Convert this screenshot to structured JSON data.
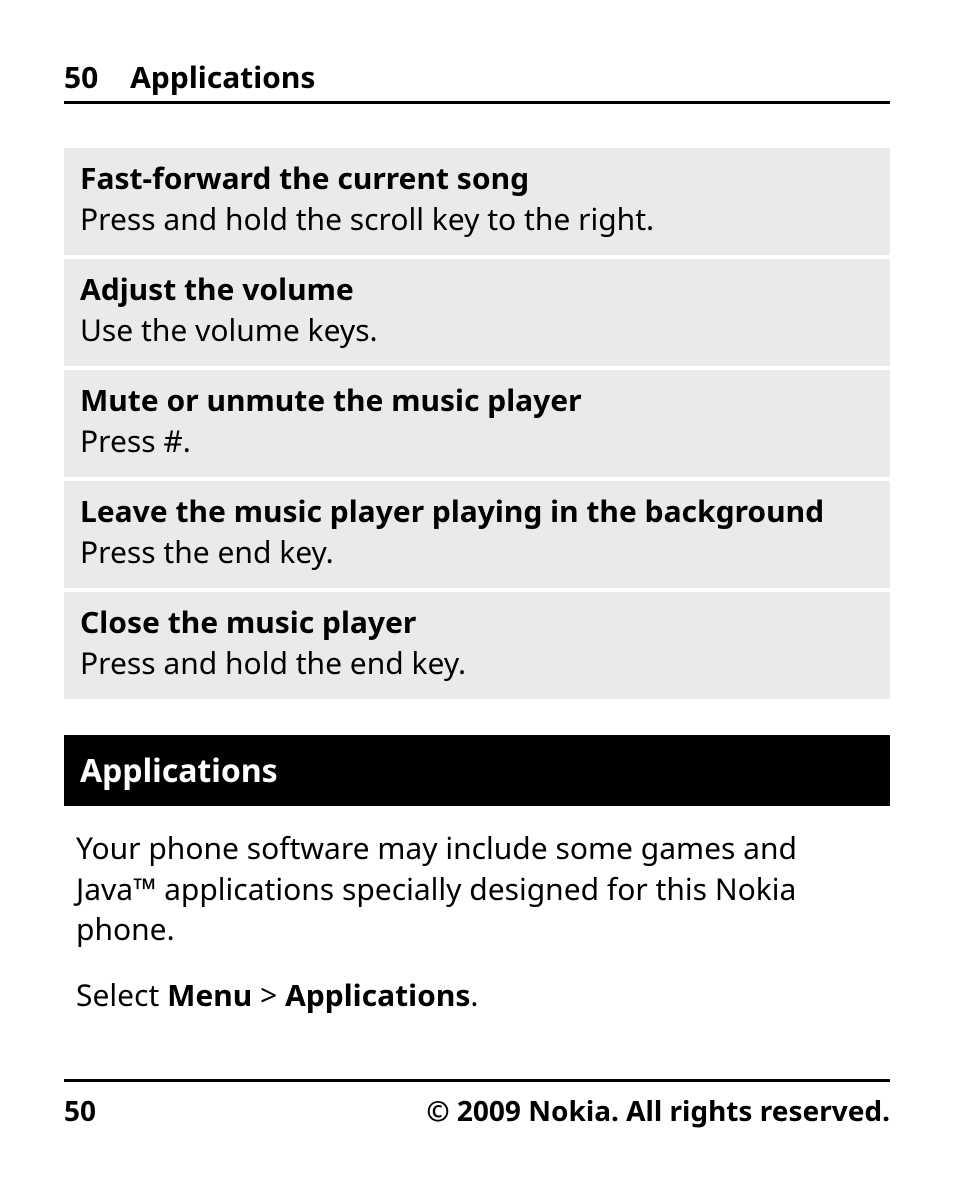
{
  "header": {
    "page_num": "50",
    "title": "Applications"
  },
  "instructions": [
    {
      "title": "Fast-forward the current song",
      "body": "Press and hold the scroll key to the right."
    },
    {
      "title": "Adjust the volume",
      "body": "Use the volume keys."
    },
    {
      "title": "Mute or unmute the music player",
      "body": "Press #."
    },
    {
      "title": "Leave the music player playing in the background",
      "body": "Press the end key."
    },
    {
      "title": "Close the music player",
      "body": "Press and hold the end key."
    }
  ],
  "section_heading": "Applications",
  "paragraph": "Your phone software may include some games and Java™ applications specially designed for this Nokia phone.",
  "select_line": {
    "prefix": "Select ",
    "menu": "Menu",
    "sep": " > ",
    "app": "Applications",
    "suffix": "."
  },
  "footer": {
    "page_num": "50",
    "copyright": "© 2009 Nokia. All rights reserved."
  }
}
